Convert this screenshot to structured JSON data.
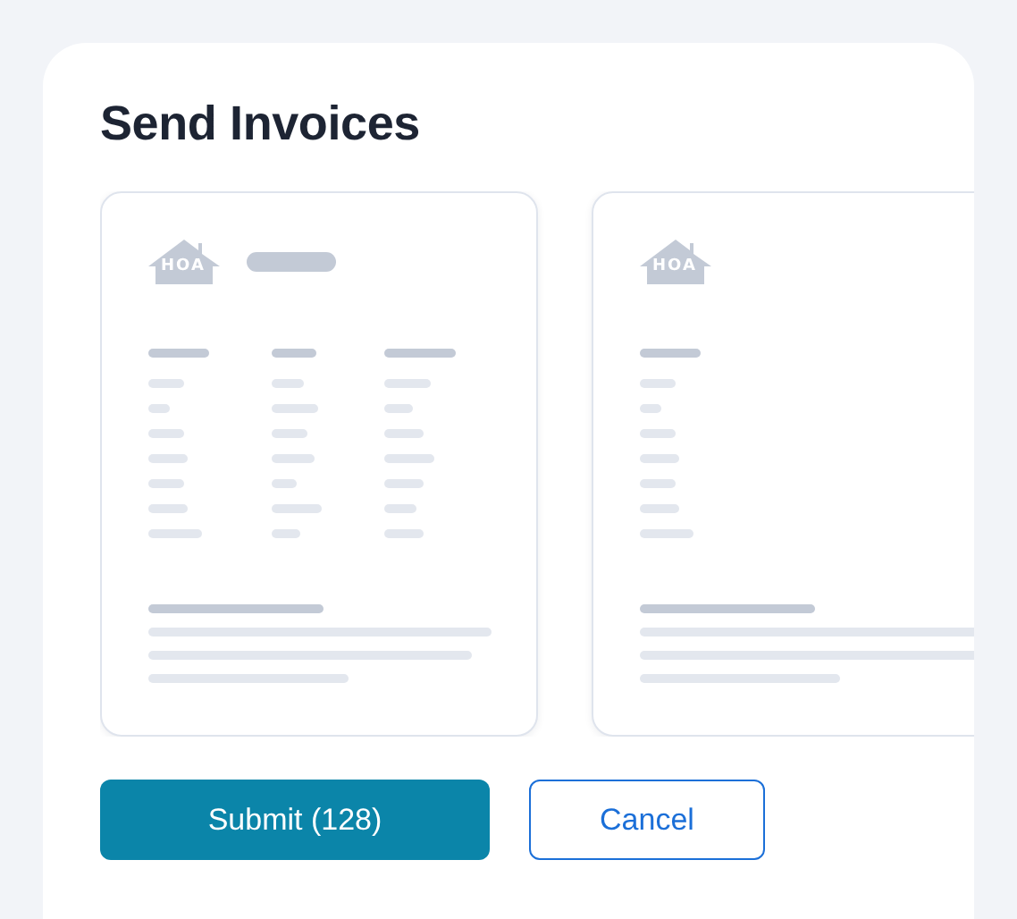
{
  "title": "Send Invoices",
  "invoices": [
    {
      "kind": "multi-column",
      "logo_text": "HOA"
    },
    {
      "kind": "single-column",
      "logo_text": "HOA"
    }
  ],
  "buttons": [
    {
      "kind": "primary",
      "label": "Submit (128)"
    },
    {
      "kind": "secondary",
      "label": "Cancel"
    }
  ]
}
